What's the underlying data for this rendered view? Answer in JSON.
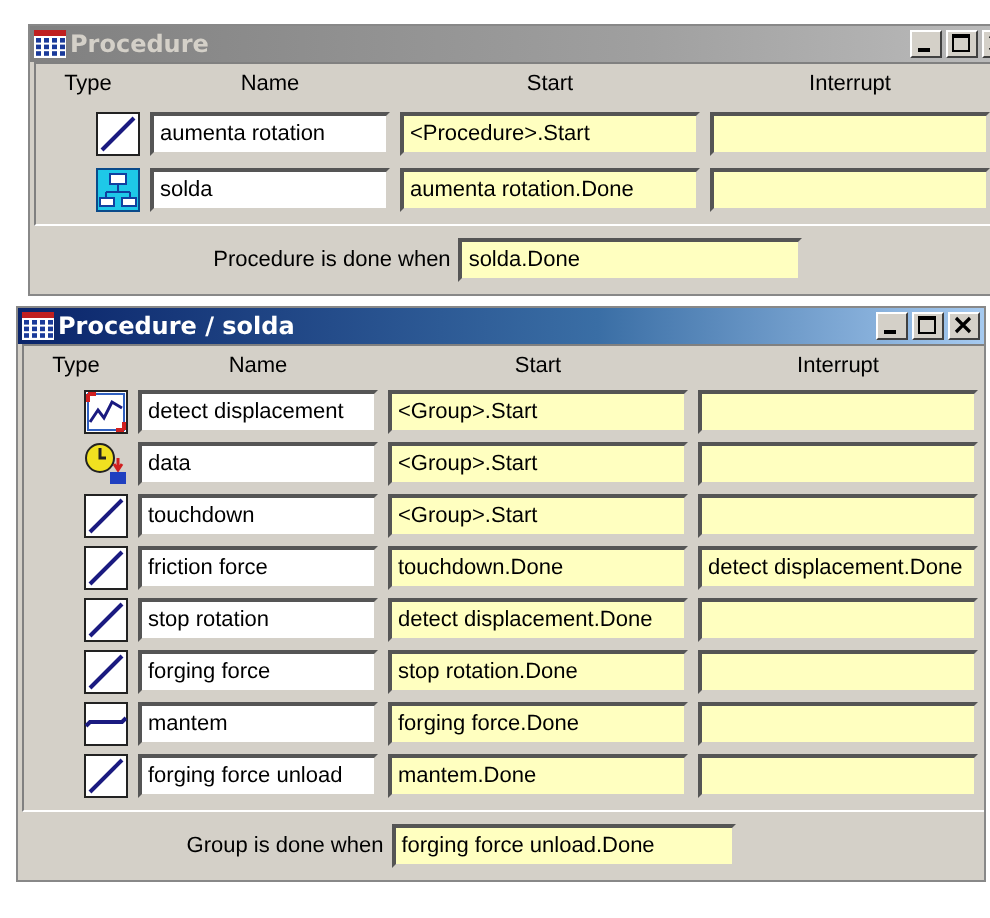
{
  "windows": [
    {
      "title": "Procedure",
      "active": false,
      "columns": [
        "Type",
        "Name",
        "Start",
        "Interrupt"
      ],
      "rows": [
        {
          "kind": "ramp",
          "name": "aumenta rotation",
          "start": "<Procedure>.Start"
        },
        {
          "kind": "group",
          "name": "solda",
          "start": "aumenta rotation.Done"
        }
      ],
      "done_label": "Procedure is done when",
      "done_value": "solda.Done"
    },
    {
      "title": "Procedure / solda",
      "active": true,
      "columns": [
        "Type",
        "Name",
        "Start",
        "Interrupt"
      ],
      "rows": [
        {
          "kind": "monitor",
          "name": "detect displacement",
          "start": "<Group>.Start"
        },
        {
          "kind": "timer",
          "name": "data",
          "start": "<Group>.Start"
        },
        {
          "kind": "ramp",
          "name": "touchdown",
          "start": "<Group>.Start"
        },
        {
          "kind": "ramp",
          "name": "friction force",
          "start": "touchdown.Done",
          "interrupt": "detect displacement.Done"
        },
        {
          "kind": "ramp",
          "name": "stop rotation",
          "start": "detect displacement.Done"
        },
        {
          "kind": "ramp",
          "name": "forging force",
          "start": "stop rotation.Done"
        },
        {
          "kind": "hold",
          "name": "mantem",
          "start": "forging force.Done"
        },
        {
          "kind": "ramp",
          "name": "forging force unload",
          "start": "mantem.Done"
        }
      ],
      "done_label": "Group is done when",
      "done_value": "forging force unload.Done"
    }
  ]
}
